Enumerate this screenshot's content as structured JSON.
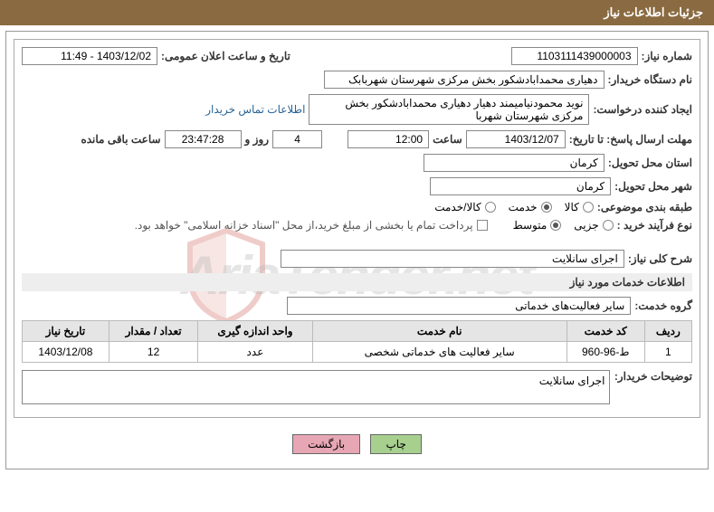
{
  "header": {
    "title": "جزئیات اطلاعات نیاز"
  },
  "form": {
    "need_number_label": "شماره نیاز:",
    "need_number": "1103111439000003",
    "announcement_label": "تاریخ و ساعت اعلان عمومی:",
    "announcement": "1403/12/02 - 11:49",
    "buyer_org_label": "نام دستگاه خریدار:",
    "buyer_org": "دهیاری محمدابادشکور بخش مرکزی شهرستان شهربابک",
    "requester_label": "ایجاد کننده درخواست:",
    "requester": "نوید محمودنیامیمند دهیار دهیاری محمدابادشکور بخش مرکزی شهرستان شهربا",
    "buyer_contact_link": "اطلاعات تماس خریدار",
    "deadline_label": "مهلت ارسال پاسخ: تا تاریخ:",
    "deadline_date": "1403/12/07",
    "hour_label": "ساعت",
    "deadline_time": "12:00",
    "days": "4",
    "days_label": "روز و",
    "countdown": "23:47:28",
    "remaining_label": "ساعت باقی مانده",
    "delivery_province_label": "استان محل تحویل:",
    "delivery_province": "کرمان",
    "delivery_city_label": "شهر محل تحویل:",
    "delivery_city": "کرمان",
    "subject_class_label": "طبقه بندی موضوعی:",
    "radios_subject": {
      "goods": "کالا",
      "service": "خدمت",
      "goods_service": "کالا/خدمت"
    },
    "purchase_type_label": "نوع فرآیند خرید :",
    "radios_type": {
      "small": "جزیی",
      "medium": "متوسط"
    },
    "payment_note": "پرداخت تمام یا بخشی از مبلغ خرید،از محل \"اسناد خزانه اسلامی\" خواهد بود."
  },
  "need": {
    "overview_label": "شرح کلی نیاز:",
    "overview": "اجرای سانلایت",
    "services_title": "اطلاعات خدمات مورد نیاز",
    "service_group_label": "گروه خدمت:",
    "service_group": "سایر فعالیت‌های خدماتی"
  },
  "table": {
    "headers": {
      "row": "ردیف",
      "code": "کد خدمت",
      "name": "نام خدمت",
      "unit": "واحد اندازه گیری",
      "qty": "تعداد / مقدار",
      "date": "تاریخ نیاز"
    },
    "rows": [
      {
        "row": "1",
        "code": "ط-96-960",
        "name": "سایر فعالیت های خدماتی شخصی",
        "unit": "عدد",
        "qty": "12",
        "date": "1403/12/08"
      }
    ]
  },
  "buyer_notes": {
    "label": "توضیحات خریدار:",
    "text": "اجرای سانلایت"
  },
  "buttons": {
    "print": "چاپ",
    "back": "بازگشت"
  },
  "watermark": "AriaTender.net"
}
